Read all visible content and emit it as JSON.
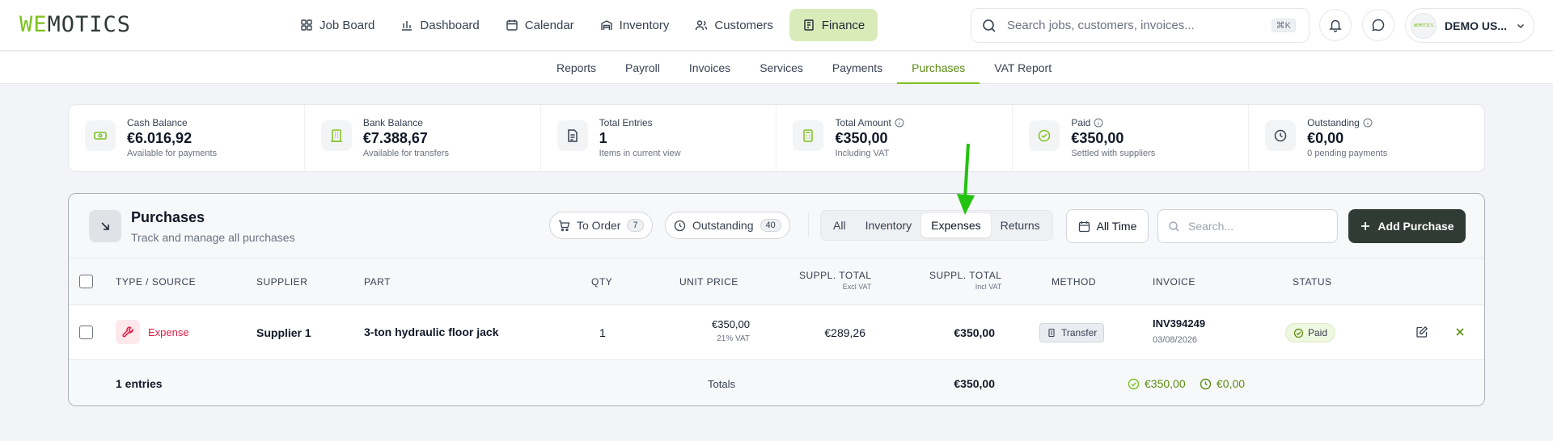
{
  "app": {
    "logo_part1": "WE",
    "logo_part2": "MOTICS"
  },
  "nav": [
    {
      "label": "Job Board",
      "icon": "grid-icon"
    },
    {
      "label": "Dashboard",
      "icon": "bar-chart-icon"
    },
    {
      "label": "Calendar",
      "icon": "calendar-icon"
    },
    {
      "label": "Inventory",
      "icon": "warehouse-icon"
    },
    {
      "label": "Customers",
      "icon": "users-icon"
    },
    {
      "label": "Finance",
      "icon": "receipt-icon",
      "active": true
    }
  ],
  "search": {
    "placeholder": "Search jobs, customers, invoices...",
    "shortcut": "⌘K"
  },
  "user": {
    "name": "DEMO US...",
    "avatar_text": "WEMOTICS"
  },
  "subnav": [
    "Reports",
    "Payroll",
    "Invoices",
    "Services",
    "Payments",
    "Purchases",
    "VAT Report"
  ],
  "subnav_active": "Purchases",
  "stats": [
    {
      "label": "Cash Balance",
      "value": "€6.016,92",
      "sub": "Available for payments",
      "icon": "cash-icon"
    },
    {
      "label": "Bank Balance",
      "value": "€7.388,67",
      "sub": "Available for transfers",
      "icon": "bank-icon"
    },
    {
      "label": "Total Entries",
      "value": "1",
      "sub": "Items in current view",
      "icon": "document-icon"
    },
    {
      "label": "Total Amount",
      "value": "€350,00",
      "sub": "Including VAT",
      "icon": "calculator-icon",
      "info": true
    },
    {
      "label": "Paid",
      "value": "€350,00",
      "sub": "Settled with suppliers",
      "icon": "check-circle-icon",
      "info": true
    },
    {
      "label": "Outstanding",
      "value": "€0,00",
      "sub": "0 pending payments",
      "icon": "clock-icon",
      "info": true
    }
  ],
  "panel": {
    "title": "Purchases",
    "subtitle": "Track and manage all purchases",
    "to_order": {
      "label": "To Order",
      "count": "7"
    },
    "outstanding": {
      "label": "Outstanding",
      "count": "40"
    },
    "filters": [
      "All",
      "Inventory",
      "Expenses",
      "Returns"
    ],
    "active_filter": "Expenses",
    "time": "All Time",
    "search_placeholder": "Search...",
    "add_label": "Add Purchase"
  },
  "table": {
    "headers": {
      "type": "TYPE / SOURCE",
      "supplier": "SUPPLIER",
      "part": "PART",
      "qty": "QTY",
      "unit_price": "UNIT PRICE",
      "suppl_total_excl": "SUPPL. TOTAL",
      "excl_note": "Excl VAT",
      "suppl_total_incl": "SUPPL. TOTAL",
      "incl_note": "Incl VAT",
      "method": "METHOD",
      "invoice": "INVOICE",
      "status": "STATUS"
    },
    "rows": [
      {
        "type": "Expense",
        "supplier": "Supplier 1",
        "part": "3-ton hydraulic floor jack",
        "qty": "1",
        "unit_price": "€350,00",
        "vat": "21% VAT",
        "total_excl": "€289,26",
        "total_incl": "€350,00",
        "method": "Transfer",
        "invoice": "INV394249",
        "invoice_date": "03/08/2026",
        "status": "Paid"
      }
    ],
    "footer": {
      "entries": "1 entries",
      "totals_label": "Totals",
      "total": "€350,00",
      "paid": "€350,00",
      "outstanding": "€0,00"
    }
  },
  "colors": {
    "accent": "#7cc21f",
    "dark": "#2f3b34",
    "expense": "#e11d48",
    "arrow": "#22c30e"
  }
}
